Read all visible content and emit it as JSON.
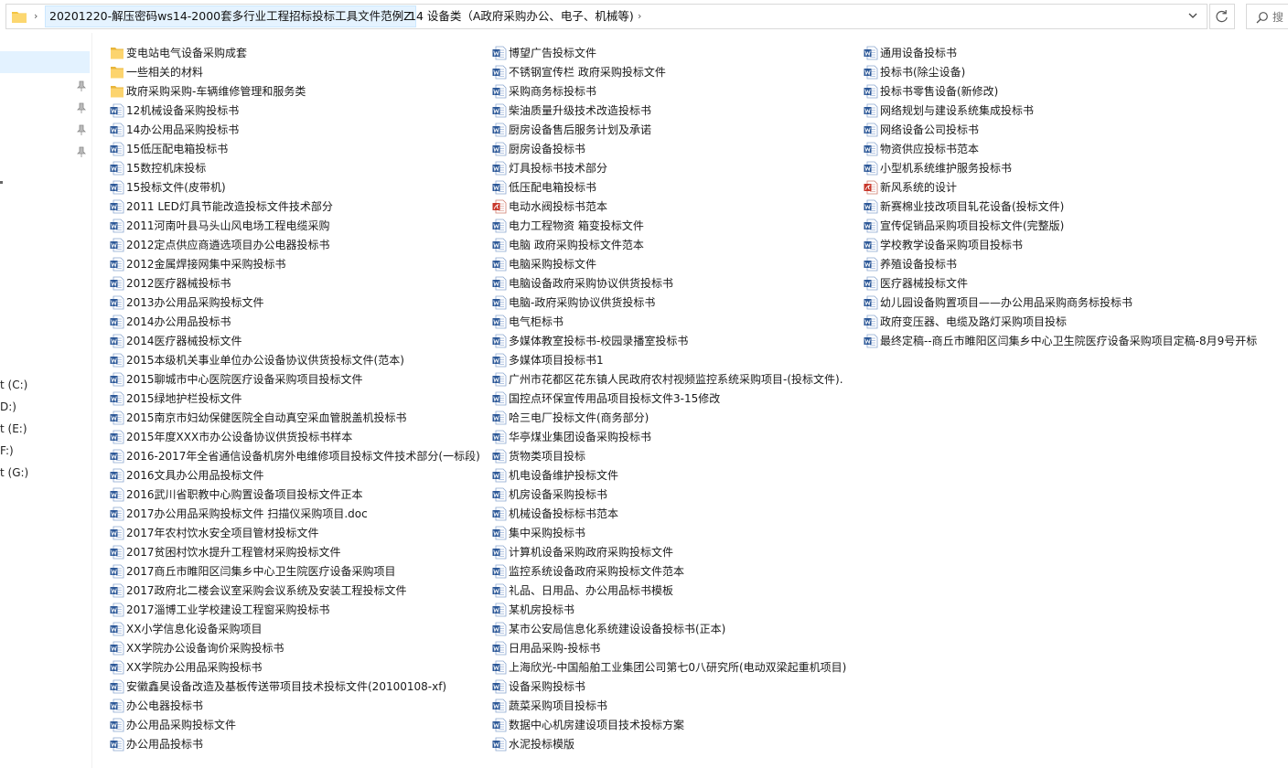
{
  "breadcrumb": [
    "20201220-解压密码ws14-2000套多行业工程招标投标工具文件范例Z",
    "14 设备类（A政府采购办公、电子、机械等)"
  ],
  "search": {
    "placeholder": "搜"
  },
  "nav": {
    "drives": [
      "t (C:)",
      "D:)",
      "t (E:)",
      "F:)",
      "t (G:)"
    ]
  },
  "columns": [
    [
      {
        "name": "变电站电气设备采购成套",
        "type": "folder"
      },
      {
        "name": "一些相关的材料",
        "type": "folder"
      },
      {
        "name": "政府采购采购-车辆维修管理和服务类",
        "type": "folder"
      },
      {
        "name": "12机械设备采购投标书",
        "type": "word"
      },
      {
        "name": "14办公用品采购投标书",
        "type": "word"
      },
      {
        "name": "15低压配电箱投标书",
        "type": "word"
      },
      {
        "name": "15数控机床投标",
        "type": "word"
      },
      {
        "name": "15投标文件(皮带机)",
        "type": "word"
      },
      {
        "name": "2011 LED灯具节能改造投标文件技术部分",
        "type": "word"
      },
      {
        "name": "2011河南叶县马头山风电场工程电缆采购",
        "type": "word"
      },
      {
        "name": "2012定点供应商遴选项目办公电器投标书",
        "type": "word"
      },
      {
        "name": "2012金属焊接网集中采购投标书",
        "type": "word"
      },
      {
        "name": "2012医疗器械投标书",
        "type": "word"
      },
      {
        "name": "2013办公用品采购投标文件",
        "type": "word"
      },
      {
        "name": "2014办公用品投标书",
        "type": "word"
      },
      {
        "name": "2014医疗器械投标文件",
        "type": "word"
      },
      {
        "name": "2015本级机关事业单位办公设备协议供货投标文件(范本)",
        "type": "word"
      },
      {
        "name": "2015聊城市中心医院医疗设备采购项目投标文件",
        "type": "word"
      },
      {
        "name": "2015绿地护栏投标文件",
        "type": "word"
      },
      {
        "name": "2015南京市妇幼保健医院全自动真空采血管脱盖机投标书",
        "type": "word"
      },
      {
        "name": "2015年度XXX市办公设备协议供货投标书样本",
        "type": "word"
      },
      {
        "name": "2016-2017年全省通信设备机房外电维修项目投标文件技术部分(一标段)",
        "type": "word"
      },
      {
        "name": "2016文具办公用品投标文件",
        "type": "word"
      },
      {
        "name": "2016武川省职教中心购置设备项目投标文件正本",
        "type": "word"
      },
      {
        "name": "2017办公用品采购投标文件 扫描仪采购项目.doc",
        "type": "word"
      },
      {
        "name": "2017年农村饮水安全项目管材投标文件",
        "type": "word"
      },
      {
        "name": "2017贫困村饮水提升工程管材采购投标文件",
        "type": "word"
      },
      {
        "name": "2017商丘市睢阳区闫集乡中心卫生院医疗设备采购项目",
        "type": "word"
      },
      {
        "name": "2017政府北二楼会议室采购会议系统及安装工程投标文件",
        "type": "word"
      },
      {
        "name": "2017淄博工业学校建设工程窗采购投标书",
        "type": "word"
      },
      {
        "name": "XX小学信息化设备采购项目",
        "type": "word"
      },
      {
        "name": "XX学院办公设备询价采购投标书",
        "type": "word"
      },
      {
        "name": "XX学院办公用品采购投标书",
        "type": "word"
      },
      {
        "name": "安徽鑫昊设备改造及基板传送带项目技术投标文件(20100108-xf)",
        "type": "word"
      },
      {
        "name": "办公电器投标书",
        "type": "word"
      },
      {
        "name": "办公用品采购投标文件",
        "type": "word"
      },
      {
        "name": "办公用品投标书",
        "type": "word"
      }
    ],
    [
      {
        "name": "博望广告投标文件",
        "type": "word"
      },
      {
        "name": "不锈钢宣传栏 政府采购投标文件",
        "type": "word"
      },
      {
        "name": "采购商务标投标书",
        "type": "word"
      },
      {
        "name": "柴油质量升级技术改造投标书",
        "type": "word"
      },
      {
        "name": "厨房设备售后服务计划及承诺",
        "type": "word"
      },
      {
        "name": "厨房设备投标书",
        "type": "word"
      },
      {
        "name": "灯具投标书技术部分",
        "type": "word"
      },
      {
        "name": "低压配电箱投标书",
        "type": "word"
      },
      {
        "name": "电动水阀投标书范本",
        "type": "pdf"
      },
      {
        "name": "电力工程物资 箱变投标文件",
        "type": "word"
      },
      {
        "name": "电脑 政府采购投标文件范本",
        "type": "word"
      },
      {
        "name": "电脑采购投标文件",
        "type": "word"
      },
      {
        "name": "电脑设备政府采购协议供货投标书",
        "type": "word"
      },
      {
        "name": "电脑-政府采购协议供货投标书",
        "type": "word"
      },
      {
        "name": "电气柜标书",
        "type": "word"
      },
      {
        "name": "多媒体教室投标书-校园录播室投标书",
        "type": "word"
      },
      {
        "name": "多媒体项目投标书1",
        "type": "word"
      },
      {
        "name": "广州市花都区花东镇人民政府农村视频监控系统采购项目-(投标文件).",
        "type": "word"
      },
      {
        "name": "国控点环保宣传用品项目投标文件3-15修改",
        "type": "word"
      },
      {
        "name": "哈三电厂投标文件(商务部分)",
        "type": "word"
      },
      {
        "name": "华亭煤业集团设备采购投标书",
        "type": "word"
      },
      {
        "name": "货物类项目投标",
        "type": "word"
      },
      {
        "name": "机电设备维护投标文件",
        "type": "word"
      },
      {
        "name": "机房设备采购投标书",
        "type": "word"
      },
      {
        "name": "机械设备投标标书范本",
        "type": "word"
      },
      {
        "name": "集中采购投标书",
        "type": "word"
      },
      {
        "name": "计算机设备采购政府采购投标文件",
        "type": "word"
      },
      {
        "name": "监控系统设备政府采购投标文件范本",
        "type": "word"
      },
      {
        "name": "礼品、日用品、办公用品标书模板",
        "type": "word"
      },
      {
        "name": "某机房投标书",
        "type": "word"
      },
      {
        "name": "某市公安局信息化系统建设设备投标书(正本)",
        "type": "word"
      },
      {
        "name": "日用品采购-投标书",
        "type": "word"
      },
      {
        "name": "上海欣光-中国船舶工业集团公司第七0八研究所(电动双梁起重机项目)",
        "type": "word"
      },
      {
        "name": "设备采购投标书",
        "type": "word"
      },
      {
        "name": "蔬菜采购项目投标书",
        "type": "word"
      },
      {
        "name": "数据中心机房建设项目技术投标方案",
        "type": "word"
      },
      {
        "name": "水泥投标模版",
        "type": "word"
      }
    ],
    [
      {
        "name": "通用设备投标书",
        "type": "word"
      },
      {
        "name": "投标书(除尘设备)",
        "type": "word"
      },
      {
        "name": "投标书零售设备(新修改)",
        "type": "word"
      },
      {
        "name": "网络规划与建设系统集成投标书",
        "type": "word"
      },
      {
        "name": "网络设备公司投标书",
        "type": "word"
      },
      {
        "name": "物资供应投标书范本",
        "type": "word"
      },
      {
        "name": "小型机系统维护服务投标书",
        "type": "word"
      },
      {
        "name": "新风系统的设计",
        "type": "pdf"
      },
      {
        "name": "新赛棉业技改项目轧花设备(投标文件)",
        "type": "word"
      },
      {
        "name": "宣传促销品采购项目投标文件(完整版)",
        "type": "word"
      },
      {
        "name": "学校教学设备采购项目投标书",
        "type": "word"
      },
      {
        "name": "养殖设备投标书",
        "type": "word"
      },
      {
        "name": "医疗器械投标文件",
        "type": "word"
      },
      {
        "name": "幼儿园设备购置项目——办公用品采购商务标投标书",
        "type": "word"
      },
      {
        "name": "政府变压器、电缆及路灯采购项目投标",
        "type": "word"
      },
      {
        "name": "最终定稿--商丘市睢阳区闫集乡中心卫生院医疗设备采购项目定稿-8月9号开标",
        "type": "word"
      }
    ]
  ]
}
